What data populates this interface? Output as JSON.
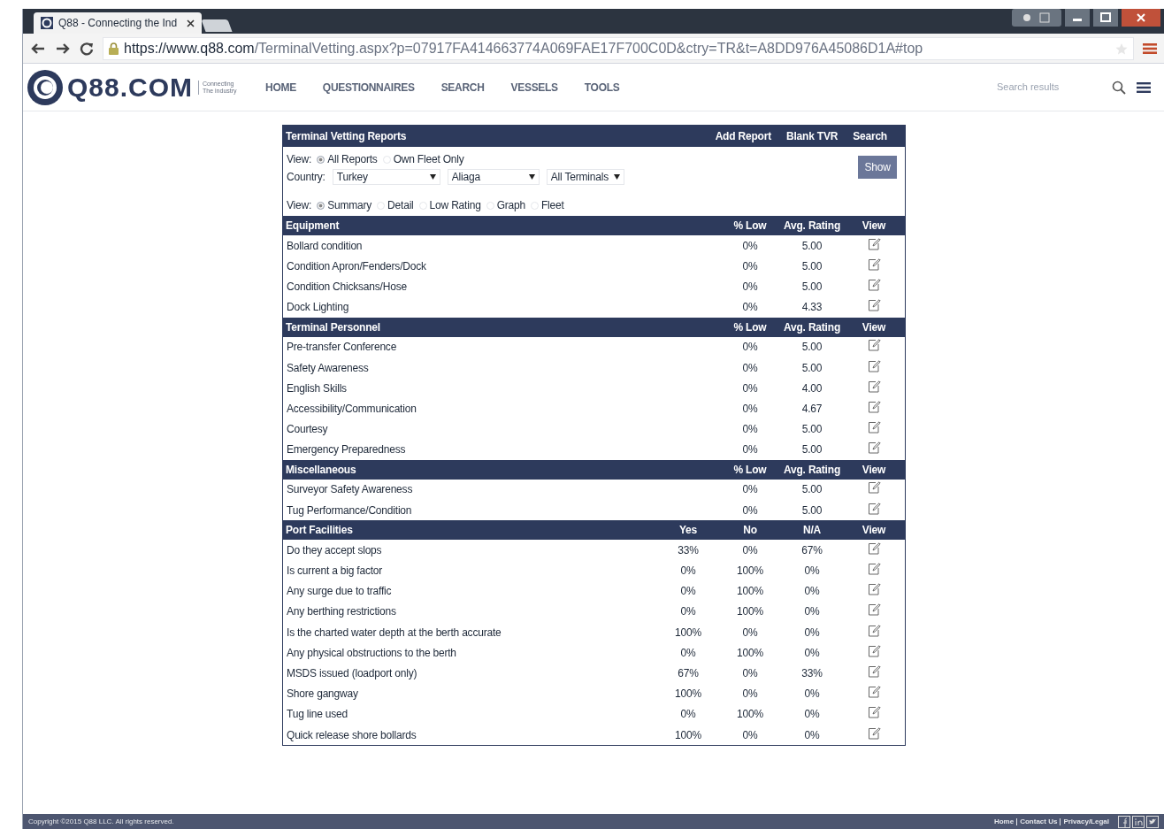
{
  "browser": {
    "tab_title": "Q88 - Connecting the Ind",
    "url_host": "https://www.q88.com",
    "url_path": "/TerminalVetting.aspx?p=07917FA414663774A069FAE17F700C0D&ctry=TR&t=A8DD976A45086D1A#top"
  },
  "site": {
    "logo": "Q88.COM",
    "tagline": "Connecting The industry",
    "nav": [
      "HOME",
      "QUESTIONNAIRES",
      "SEARCH",
      "VESSELS",
      "TOOLS"
    ],
    "search_placeholder": "Search results"
  },
  "panel": {
    "title": "Terminal Vetting Reports",
    "actions": [
      "Add Report",
      "Blank TVR",
      "Search"
    ],
    "filter_view": {
      "label": "View:",
      "options": [
        {
          "label": "All Reports",
          "selected": true
        },
        {
          "label": "Own Fleet Only",
          "selected": false
        }
      ]
    },
    "country": {
      "label": "Country:",
      "selects": [
        "Turkey",
        "Aliaga",
        "All Terminals"
      ]
    },
    "show_button": "Show",
    "display_view": {
      "label": "View:",
      "options": [
        {
          "label": "Summary",
          "selected": true
        },
        {
          "label": "Detail",
          "selected": false
        },
        {
          "label": "Low Rating",
          "selected": false
        },
        {
          "label": "Graph",
          "selected": false
        },
        {
          "label": "Fleet",
          "selected": false
        }
      ]
    },
    "sections": [
      {
        "title": "Equipment",
        "columns": [
          "% Low",
          "Avg. Rating",
          "View"
        ],
        "rows": [
          {
            "name": "Bollard condition",
            "values": [
              "0%",
              "5.00"
            ]
          },
          {
            "name": "Condition Apron/Fenders/Dock",
            "values": [
              "0%",
              "5.00"
            ]
          },
          {
            "name": "Condition Chicksans/Hose",
            "values": [
              "0%",
              "5.00"
            ]
          },
          {
            "name": "Dock Lighting",
            "values": [
              "0%",
              "4.33"
            ]
          }
        ]
      },
      {
        "title": "Terminal Personnel",
        "columns": [
          "% Low",
          "Avg. Rating",
          "View"
        ],
        "rows": [
          {
            "name": "Pre-transfer Conference",
            "values": [
              "0%",
              "5.00"
            ]
          },
          {
            "name": "Safety Awareness",
            "values": [
              "0%",
              "5.00"
            ]
          },
          {
            "name": "English Skills",
            "values": [
              "0%",
              "4.00"
            ]
          },
          {
            "name": "Accessibility/Communication",
            "values": [
              "0%",
              "4.67"
            ]
          },
          {
            "name": "Courtesy",
            "values": [
              "0%",
              "5.00"
            ]
          },
          {
            "name": "Emergency Preparedness",
            "values": [
              "0%",
              "5.00"
            ]
          }
        ]
      },
      {
        "title": "Miscellaneous",
        "columns": [
          "% Low",
          "Avg. Rating",
          "View"
        ],
        "rows": [
          {
            "name": "Surveyor Safety Awareness",
            "values": [
              "0%",
              "5.00"
            ]
          },
          {
            "name": "Tug Performance/Condition",
            "values": [
              "0%",
              "5.00"
            ]
          }
        ]
      },
      {
        "title": "Port Facilities",
        "columns": [
          "Yes",
          "No",
          "N/A",
          "View"
        ],
        "rows": [
          {
            "name": "Do they accept slops",
            "values": [
              "33%",
              "0%",
              "67%"
            ]
          },
          {
            "name": "Is current a big factor",
            "values": [
              "0%",
              "100%",
              "0%"
            ]
          },
          {
            "name": "Any surge due to traffic",
            "values": [
              "0%",
              "100%",
              "0%"
            ]
          },
          {
            "name": "Any berthing restrictions",
            "values": [
              "0%",
              "100%",
              "0%"
            ]
          },
          {
            "name": "Is the charted water depth at the berth accurate",
            "values": [
              "100%",
              "0%",
              "0%"
            ]
          },
          {
            "name": "Any physical obstructions to the berth",
            "values": [
              "0%",
              "100%",
              "0%"
            ]
          },
          {
            "name": "MSDS issued (loadport only)",
            "values": [
              "67%",
              "0%",
              "33%"
            ]
          },
          {
            "name": "Shore gangway",
            "values": [
              "100%",
              "0%",
              "0%"
            ]
          },
          {
            "name": "Tug line used",
            "values": [
              "0%",
              "100%",
              "0%"
            ]
          },
          {
            "name": "Quick release shore bollards",
            "values": [
              "100%",
              "0%",
              "0%"
            ]
          }
        ]
      }
    ]
  },
  "footer": {
    "copyright": "Copyright ©2015 Q88 LLC. All rights reserved.",
    "links": [
      "Home",
      "Contact Us",
      "Privacy/Legal"
    ]
  }
}
